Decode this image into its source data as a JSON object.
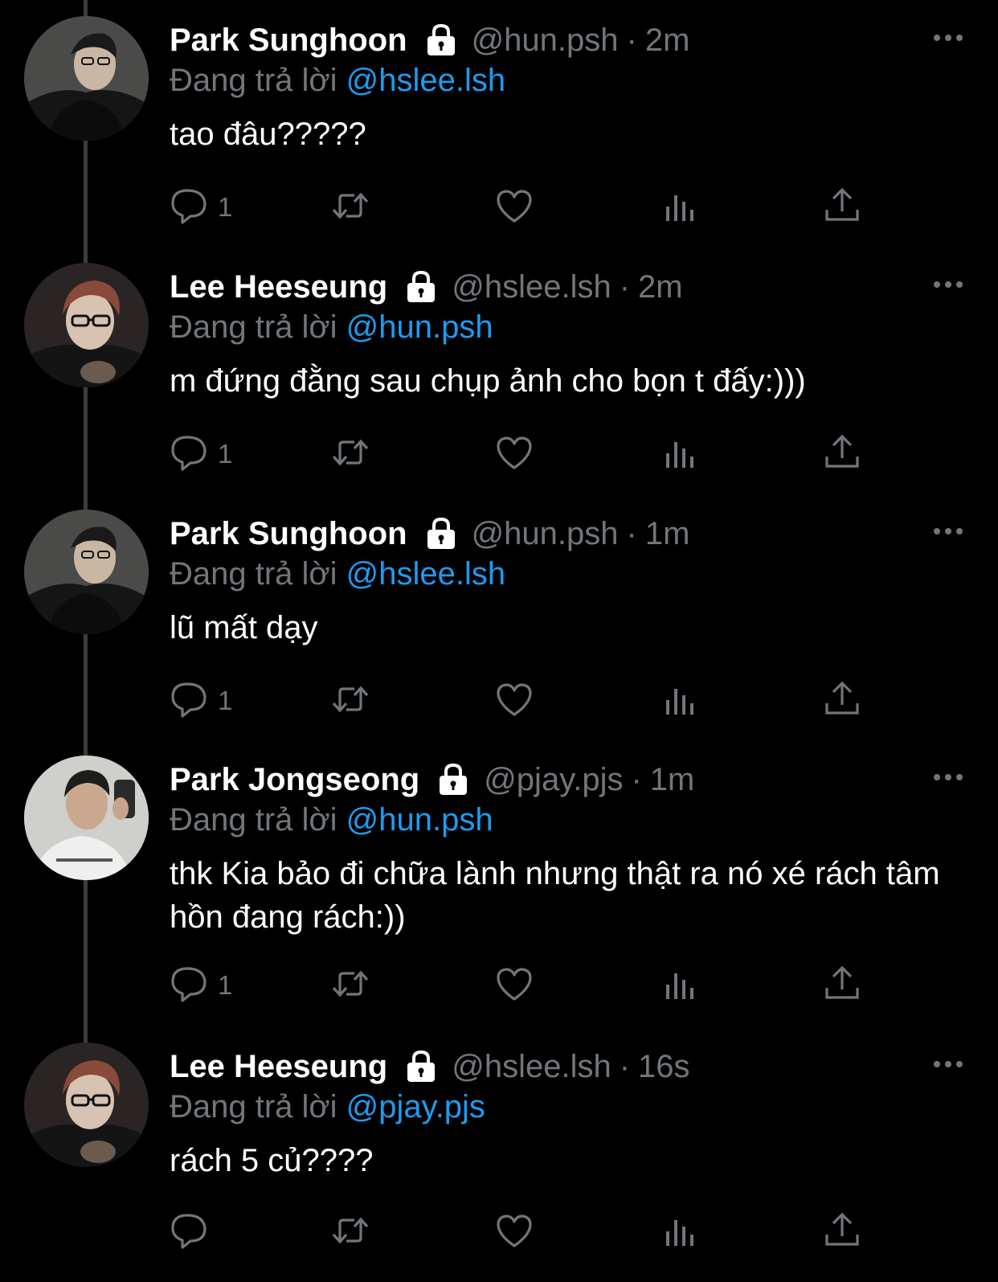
{
  "tweets": [
    {
      "name": "Park Sunghoon",
      "handle": "@hun.psh",
      "time": "2m",
      "reply_prefix": "Đang trả lời",
      "reply_to": "@hslee.lsh",
      "text": "tao đâu?????",
      "reply_count": "1",
      "avatar": "sunghoon"
    },
    {
      "name": "Lee Heeseung",
      "handle": "@hslee.lsh",
      "time": "2m",
      "reply_prefix": "Đang trả lời",
      "reply_to": "@hun.psh",
      "text": "m đứng đằng sau chụp ảnh cho bọn t đấy:)))",
      "reply_count": "1",
      "avatar": "heeseung"
    },
    {
      "name": "Park Sunghoon",
      "handle": "@hun.psh",
      "time": "1m",
      "reply_prefix": "Đang trả lời",
      "reply_to": "@hslee.lsh",
      "text": "lũ mất dạy",
      "reply_count": "1",
      "avatar": "sunghoon"
    },
    {
      "name": "Park Jongseong",
      "handle": "@pjay.pjs",
      "time": "1m",
      "reply_prefix": "Đang trả lời",
      "reply_to": "@hun.psh",
      "text": "thk Kia bảo đi chữa lành nhưng thật ra nó xé rách tâm hồn đang rách:))",
      "reply_count": "1",
      "avatar": "jongseong"
    },
    {
      "name": "Lee Heeseung",
      "handle": "@hslee.lsh",
      "time": "16s",
      "reply_prefix": "Đang trả lời",
      "reply_to": "@pjay.pjs",
      "text": "rách 5 củ????",
      "reply_count": "",
      "avatar": "heeseung"
    }
  ],
  "separator": "·",
  "icons": [
    "lock-icon",
    "more-icon",
    "reply-icon",
    "retweet-icon",
    "like-icon",
    "views-icon",
    "share-icon"
  ],
  "colors": {
    "background": "#000000",
    "link": "#1d9bf0",
    "muted": "#71767b",
    "text": "#ffffff"
  }
}
